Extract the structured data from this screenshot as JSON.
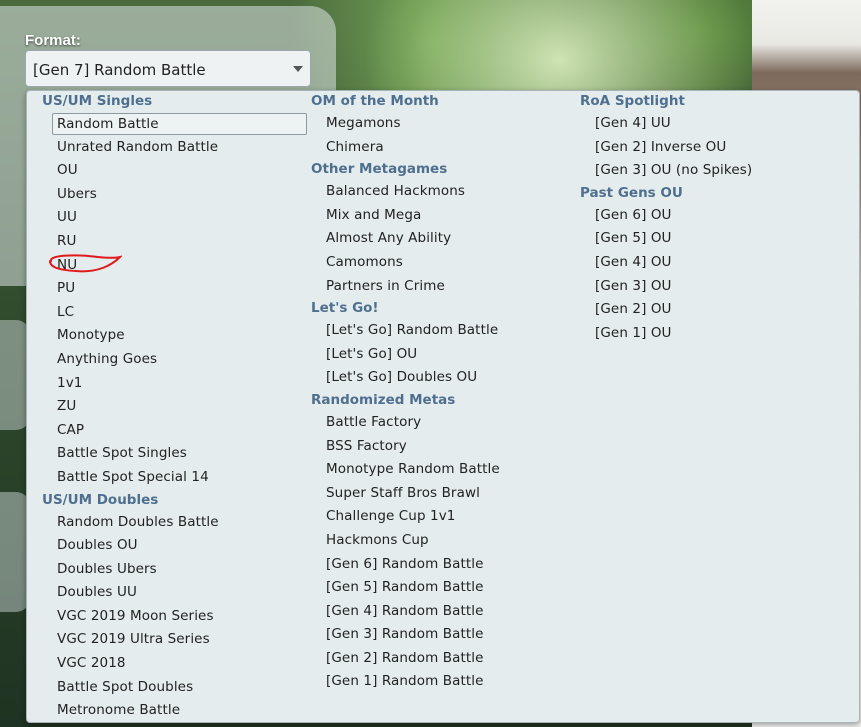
{
  "format": {
    "label": "Format:",
    "selected": "[Gen 7] Random Battle"
  },
  "menu": {
    "columns": [
      {
        "groups": [
          {
            "title": "US/UM Singles",
            "items": [
              "Random Battle",
              "Unrated Random Battle",
              "OU",
              "Ubers",
              "UU",
              "RU",
              "NU",
              "PU",
              "LC",
              "Monotype",
              "Anything Goes",
              "1v1",
              "ZU",
              "CAP",
              "Battle Spot Singles",
              "Battle Spot Special 14"
            ]
          },
          {
            "title": "US/UM Doubles",
            "items": [
              "Random Doubles Battle",
              "Doubles OU",
              "Doubles Ubers",
              "Doubles UU",
              "VGC 2019 Moon Series",
              "VGC 2019 Ultra Series",
              "VGC 2018",
              "Battle Spot Doubles",
              "Metronome Battle"
            ]
          }
        ]
      },
      {
        "groups": [
          {
            "title": "OM of the Month",
            "items": [
              "Megamons",
              "Chimera"
            ]
          },
          {
            "title": "Other Metagames",
            "items": [
              "Balanced Hackmons",
              "Mix and Mega",
              "Almost Any Ability",
              "Camomons",
              "Partners in Crime"
            ]
          },
          {
            "title": "Let's Go!",
            "items": [
              "[Let's Go] Random Battle",
              "[Let's Go] OU",
              "[Let's Go] Doubles OU"
            ]
          },
          {
            "title": "Randomized Metas",
            "items": [
              "Battle Factory",
              "BSS Factory",
              "Monotype Random Battle",
              "Super Staff Bros Brawl",
              "Challenge Cup 1v1",
              "Hackmons Cup",
              "[Gen 6] Random Battle",
              "[Gen 5] Random Battle",
              "[Gen 4] Random Battle",
              "[Gen 3] Random Battle",
              "[Gen 2] Random Battle",
              "[Gen 1] Random Battle"
            ]
          }
        ]
      },
      {
        "groups": [
          {
            "title": "RoA Spotlight",
            "items": [
              "[Gen 4] UU",
              "[Gen 2] Inverse OU",
              "[Gen 3] OU (no Spikes)"
            ]
          },
          {
            "title": "Past Gens OU",
            "items": [
              "[Gen 6] OU",
              "[Gen 5] OU",
              "[Gen 4] OU",
              "[Gen 3] OU",
              "[Gen 2] OU",
              "[Gen 1] OU"
            ]
          }
        ]
      }
    ]
  },
  "colors": {
    "group_title": "#4f6f8f",
    "menu_bg": "#e5ecee",
    "annotation": "#e0191b"
  }
}
